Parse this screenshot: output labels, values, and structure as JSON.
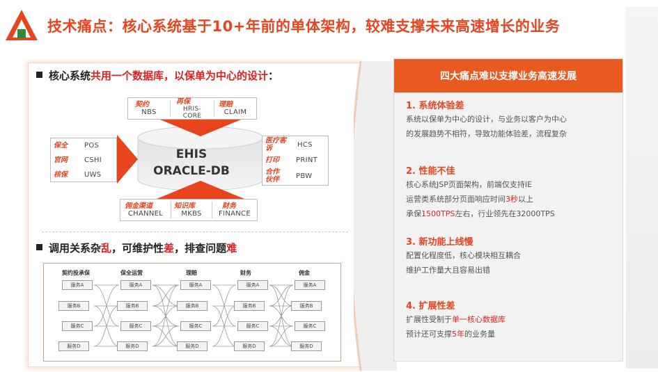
{
  "header": {
    "title": "技术痛点：核心系统基于10+年前的单体架构，较难支撑未来高速增长的业务"
  },
  "section1": {
    "prefix": "核心系统",
    "highlight": "共用一个数据库，以保单为中心的设计",
    "suffix": "："
  },
  "database": {
    "line1": "EHIS",
    "line2": "ORACLE-DB"
  },
  "top_box": [
    {
      "label": "契约",
      "value": "NBS"
    },
    {
      "label": "再保",
      "value": "HRIS-CORE"
    },
    {
      "label": "理赔",
      "value": "CLAIM"
    }
  ],
  "left_box": [
    {
      "label": "保全",
      "value": "POS"
    },
    {
      "label": "官网",
      "value": "CSHI"
    },
    {
      "label": "核保",
      "value": "UWS"
    }
  ],
  "right_box": [
    {
      "label": "医疗客诉",
      "value": "HCS"
    },
    {
      "label": "打印",
      "value": "PRINT"
    },
    {
      "label": "合作伙伴",
      "value": "PBW"
    }
  ],
  "bottom_box": [
    {
      "label": "佣金渠道",
      "value": "CHANNEL"
    },
    {
      "label": "知识库",
      "value": "MKBS"
    },
    {
      "label": "财务",
      "value": "FINANCE"
    }
  ],
  "section2": {
    "p1": "调用关系杂",
    "r1": "乱",
    "p2": "，可维护性",
    "r2": "差",
    "p3": "，排查问题",
    "r3": "难"
  },
  "flow": {
    "columns": [
      "契约投承保",
      "保全运营",
      "理赔",
      "财务",
      "佣金"
    ],
    "services": [
      "服务A",
      "服务B",
      "服务C",
      "服务D"
    ]
  },
  "right_panel": {
    "header": "四大痛点难以支撑业务高速发展",
    "points": [
      {
        "title": "1. 系统体验差",
        "lines": [
          {
            "pre": "系统以保单为中心的设计，与业务以客户为中心",
            "hl": "",
            "post": ""
          },
          {
            "pre": "的发展趋势不相符，导致功能体验差，流程复杂",
            "hl": "",
            "post": ""
          }
        ]
      },
      {
        "title": "2. 性能不佳",
        "lines": [
          {
            "pre": "核心系统JSP页面架构，前端仅支持IE",
            "hl": "",
            "post": ""
          },
          {
            "pre": "运营类系统部分页面响应时间",
            "hl": "3秒",
            "post": "以上"
          },
          {
            "pre": "承保",
            "hl": "1500TPS",
            "post": "左右，行业领先在32000TPS"
          }
        ]
      },
      {
        "title": "3. 新功能上线慢",
        "lines": [
          {
            "pre": "配置化程度低，核心模块相互耦合",
            "hl": "",
            "post": ""
          },
          {
            "pre": "维护工作量大且容易出错",
            "hl": "",
            "post": ""
          }
        ]
      },
      {
        "title": "4. 扩展性差",
        "lines": [
          {
            "pre": "扩展性受制于",
            "hl": "单一核心数据库",
            "post": ""
          },
          {
            "pre": "预计还可支撑",
            "hl": "5年",
            "post": "的业务量"
          }
        ]
      }
    ]
  },
  "colors": {
    "accent": "#e8441e",
    "header_bg": "#ea5a20",
    "highlight": "#e02020",
    "logo_green": "#2e8b3a"
  },
  "icons": {
    "logo": "company-logo-triangle-icon"
  }
}
